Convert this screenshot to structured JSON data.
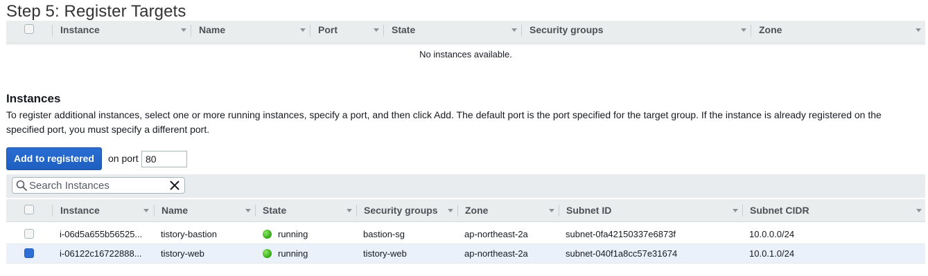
{
  "page": {
    "title": "Step 5: Register Targets"
  },
  "registered_table": {
    "columns": [
      "Instance",
      "Name",
      "Port",
      "State",
      "Security groups",
      "Zone"
    ],
    "empty_message": "No instances available."
  },
  "instances": {
    "title": "Instances",
    "description": "To register additional instances, select one or more running instances, specify a port, and then click Add. The default port is the port specified for the target group. If the instance is already registered on the specified port, you must specify a different port.",
    "add_button_label": "Add to registered",
    "port_label": "on port",
    "port_value": "80",
    "search": {
      "placeholder": "Search Instances",
      "value": ""
    },
    "columns": [
      "Instance",
      "Name",
      "State",
      "Security groups",
      "Zone",
      "Subnet ID",
      "Subnet CIDR"
    ],
    "rows": [
      {
        "instance": "i-06d5a655b56525...",
        "name": "tistory-bastion",
        "state": "running",
        "security_groups": "bastion-sg",
        "zone": "ap-northeast-2a",
        "subnet_id": "subnet-0fa42150337e6873f",
        "subnet_cidr": "10.0.0.0/24",
        "checked": false
      },
      {
        "instance": "i-06122c16722888...",
        "name": "tistory-web",
        "state": "running",
        "security_groups": "tistory-web",
        "zone": "ap-northeast-2a",
        "subnet_id": "subnet-040f1a8cc57e31674",
        "subnet_cidr": "10.0.1.0/24",
        "checked": true
      }
    ]
  },
  "colors": {
    "primary_button": "#1e5fc0",
    "running_status": "#2ea80c",
    "selected_row": "#eaf1fb",
    "header_bg": "#eaeded"
  }
}
